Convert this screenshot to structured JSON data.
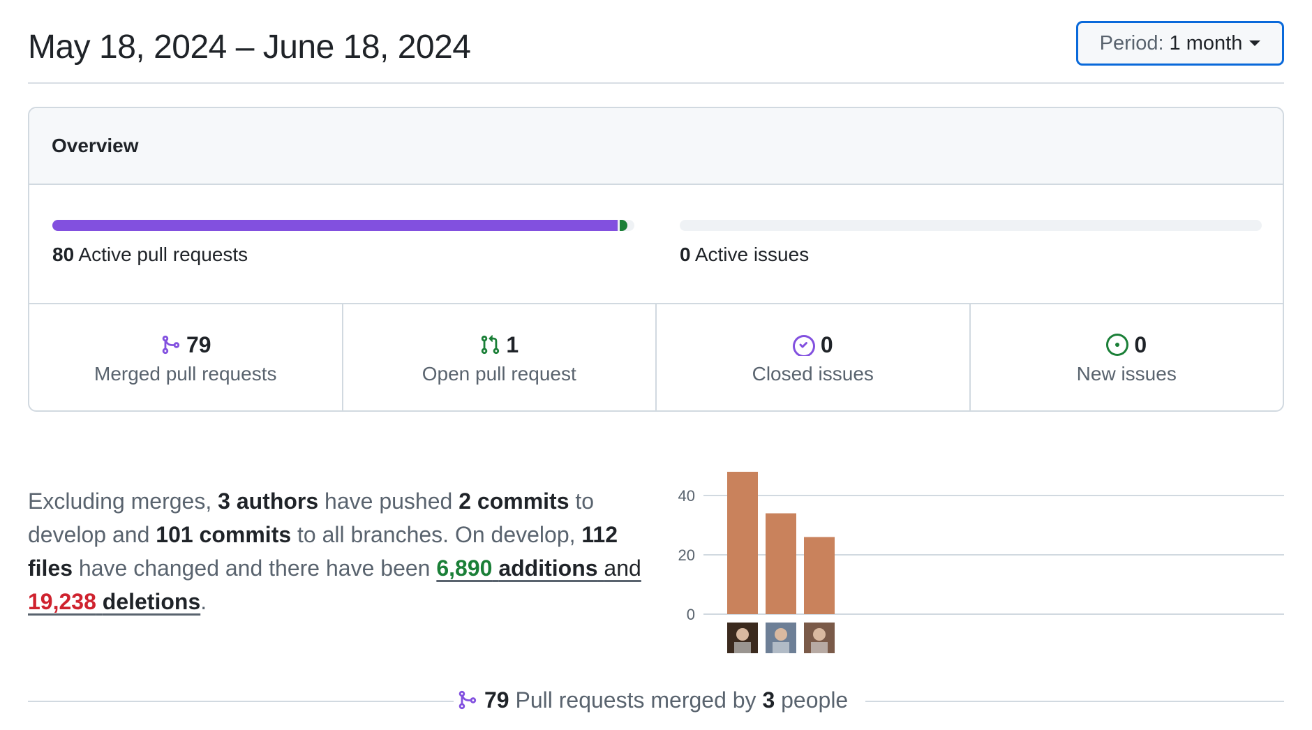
{
  "header": {
    "title": "May 18, 2024 – June 18, 2024",
    "period_label": "Period:",
    "period_value": "1 month"
  },
  "overview": {
    "title": "Overview",
    "pull_requests": {
      "count": "80",
      "label": "Active pull requests",
      "merged_fraction": 0.9875,
      "open_fraction": 0.0125
    },
    "issues": {
      "count": "0",
      "label": "Active issues",
      "fraction": 0
    },
    "stats": [
      {
        "icon": "git-merge-icon",
        "count": "79",
        "label": "Merged pull requests",
        "color": "#8250df"
      },
      {
        "icon": "git-pull-request-icon",
        "count": "1",
        "label": "Open pull request",
        "color": "#1a7f37"
      },
      {
        "icon": "issue-closed-icon",
        "count": "0",
        "label": "Closed issues",
        "color": "#8250df"
      },
      {
        "icon": "issue-opened-icon",
        "count": "0",
        "label": "New issues",
        "color": "#1a7f37"
      }
    ]
  },
  "summary": {
    "p1": "Excluding merges,",
    "authors": "3 authors",
    "p2": "have pushed",
    "commits_develop": "2 commits",
    "p3": "to develop and",
    "commits_all": "101 commits",
    "p4": "to all branches. On develop,",
    "files": "112 files",
    "p5": "have changed and there have been",
    "additions_num": "6,890",
    "additions_word": "additions",
    "p6": "and",
    "deletions_num": "19,238",
    "deletions_word": "deletions",
    "p7": "."
  },
  "chart_data": {
    "type": "bar",
    "categories": [
      "author-1",
      "author-2",
      "author-3"
    ],
    "values": [
      48,
      34,
      26
    ],
    "yticks": [
      0,
      20,
      40
    ],
    "ylim": [
      0,
      48
    ],
    "bar_color": "#c9825c",
    "avatar_colors": [
      "#3b2a1e",
      "#6d7f96",
      "#7a5a48"
    ]
  },
  "footer": {
    "count": "79",
    "text1": "Pull requests merged by",
    "people": "3",
    "text2": "people"
  }
}
